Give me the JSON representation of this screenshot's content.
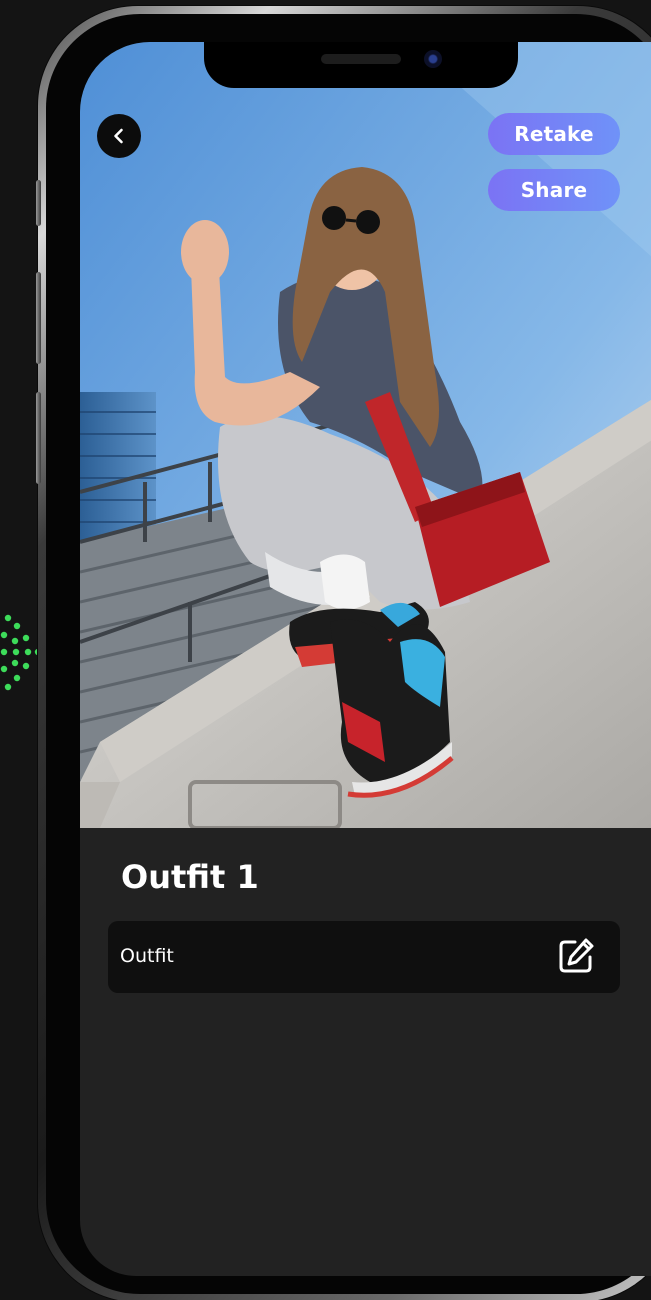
{
  "header": {
    "back_icon": "chevron-left-icon"
  },
  "actions": {
    "retake_label": "Retake",
    "share_label": "Share"
  },
  "photo": {
    "subject": "outfit photo"
  },
  "outfit": {
    "title": "Outfit 1",
    "field_label": "Outfit",
    "edit_icon": "edit-icon"
  },
  "colors": {
    "accent_start": "#7b73f4",
    "accent_end": "#6f92f8",
    "screen_background": "#222222",
    "card_background": "#0f0f0f",
    "decoration_green": "#3ddc5a"
  }
}
